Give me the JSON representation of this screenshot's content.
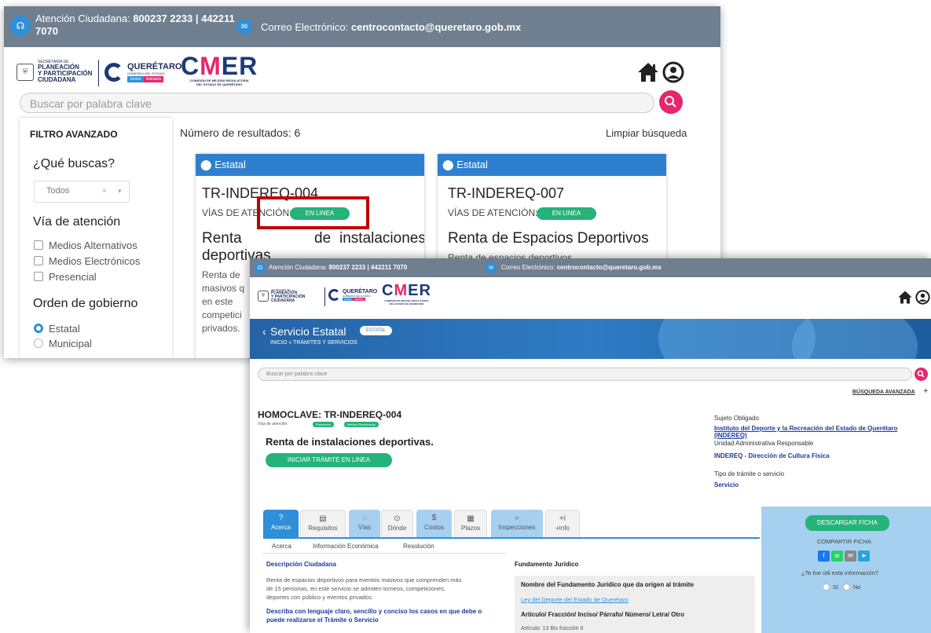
{
  "back": {
    "topbar": {
      "attention_label": "Atención Ciudadana:",
      "attention_phone": "800237 2233 | 442211",
      "attention_phone_2": "7070",
      "email_label": "Correo Electrónico:",
      "email": "centrocontacto@queretaro.gob.mx"
    },
    "logos": {
      "sec_small": "SECRETARÍA DE",
      "sec_line1": "PLANEACIÓN",
      "sec_line2": "Y PARTICIPACIÓN",
      "sec_line3": "CIUDADANA",
      "sec_state": "QUERÉTARO",
      "queretaro": "QUERÉTARO",
      "gobierno": "GOBIERNO DEL ESTADO",
      "pill_juntos": "Juntos",
      "pill_adelante": "Adelante",
      "cmer_c": "C",
      "cmer_m": "M",
      "cmer_er": "ER",
      "cmer_sub1": "COMISIÓN DE MEJORA REGULATORIA",
      "cmer_sub2": "DEL ESTADO DE QUERÉTARO"
    },
    "search_placeholder": "Buscar por palabra clave",
    "sidebar": {
      "title": "FILTRO AVANZADO",
      "que_buscas": "¿Qué buscas?",
      "select_value": "Todos",
      "select_clear": "×",
      "select_arrow": "▾",
      "via_title": "Vía de atención",
      "via_options": [
        "Medios Alternativos",
        "Medios Electrónicos",
        "Presencial"
      ],
      "orden_title": "Orden de gobierno",
      "orden_options": [
        "Estatal",
        "Municipal"
      ]
    },
    "results_label": "Número de resultados: 6",
    "clear_search": "Limpiar búsqueda",
    "cards": [
      {
        "head": "Estatal",
        "code": "TR-INDEREQ-004",
        "via_label": "VÍAS DE ATENCIÓN:",
        "via_pill": "EN LINEA",
        "title_line1_a": "Renta",
        "title_line1_b": "de",
        "title_line1_c": "instalaciones",
        "title_line2": "deportivas",
        "desc_lines": [
          "Renta de",
          "masivos q",
          "en este",
          "competici",
          "privados."
        ]
      },
      {
        "head": "Estatal",
        "code": "TR-INDEREQ-007",
        "via_label": "VÍAS DE ATENCIÓN:",
        "via_pill": "EN LINEA",
        "title": "Renta de Espacios Deportivos",
        "desc_cut": "Renta de espacios deportivos"
      }
    ]
  },
  "front": {
    "topbar": {
      "attention_label": "Atención Ciudadana:",
      "attention_phone": "800237 2233 | 442211 7070",
      "email_label": "Correo Electrónico:",
      "email": "centrocontacto@queretaro.gob.mx"
    },
    "banner": {
      "back_arrow": "‹",
      "title": "Servicio Estatal",
      "badge": "ESTATAL",
      "breadcrumb": "INICIO » TRÁMITES Y SERVICIOS"
    },
    "search_placeholder": "Buscar por palabra clave",
    "advanced": "BÚSQUEDA AVANZADA",
    "advanced_plus": "+",
    "homoclave": "HOMOCLAVE: TR-INDEREQ-004",
    "vias_label": "Vías de atención:",
    "vias_pills": [
      "Presencial",
      "Medios Electrónicos"
    ],
    "tramite_title": "Renta de instalaciones deportivas.",
    "start_button": "INICIAR TRÁMITE EN LINEA",
    "sujeto_label": "Sujeto Obligado",
    "sujeto_link_1": "Instituto del Deporte y la Recreación del Estado de Querétaro",
    "sujeto_link_2": "(INDEREQ)",
    "unidad_label": "Unidad Administrativa Responsable",
    "unidad_value": "INDEREQ - Dirección de Cultura Física",
    "tipo_label": "Tipo de trámite o servicio",
    "tipo_value": "Servicio",
    "tabs": [
      {
        "icon": "?",
        "label": "Acerca"
      },
      {
        "icon": "▤",
        "label": "Requisitos"
      },
      {
        "icon": "◌",
        "label": "Vías"
      },
      {
        "icon": "⊙",
        "label": "Dónde"
      },
      {
        "icon": "$",
        "label": "Costos"
      },
      {
        "icon": "▦",
        "label": "Plazos"
      },
      {
        "icon": "⌕",
        "label": "Inspecciones"
      },
      {
        "icon": "+i",
        "label": "+Info"
      }
    ],
    "subtabs": [
      "Acerca",
      "Información Económica",
      "Resolución"
    ],
    "desc_title": "Descripción Ciudadana",
    "desc_lines": [
      "Renta de espacios deportivos para eventos masivos que comprenden más",
      "de 15 personas, en este servicio se admiten torneos, competiciones,",
      "deportes con público y eventos privados."
    ],
    "casos_title_1": "Describa con lenguaje claro, sencillo y conciso los casos en que debe o",
    "casos_title_2": "puede realizarse el Trámite o Servicio",
    "fundamento_title": "Fundamento Jurídico",
    "fundamento_q": "Nombre del Fundamento Jurídico que da origen al trámite",
    "fundamento_link": "Ley del Deporte del Estado de Querétaro",
    "articulo_q": "Artículo/ Fracción/ Inciso/ Párrafo/ Número/ Letra/ Otro",
    "articulo_value": "Artículo: 13 Bis fracción II",
    "download": "DESCARGAR FICHA",
    "share_label": "COMPARTIR FICHA",
    "share_icons": [
      "f",
      "w",
      "✉",
      "➤"
    ],
    "useful_q": "¿Te fue útil esta información?",
    "yes": "Sí",
    "no": "No"
  }
}
